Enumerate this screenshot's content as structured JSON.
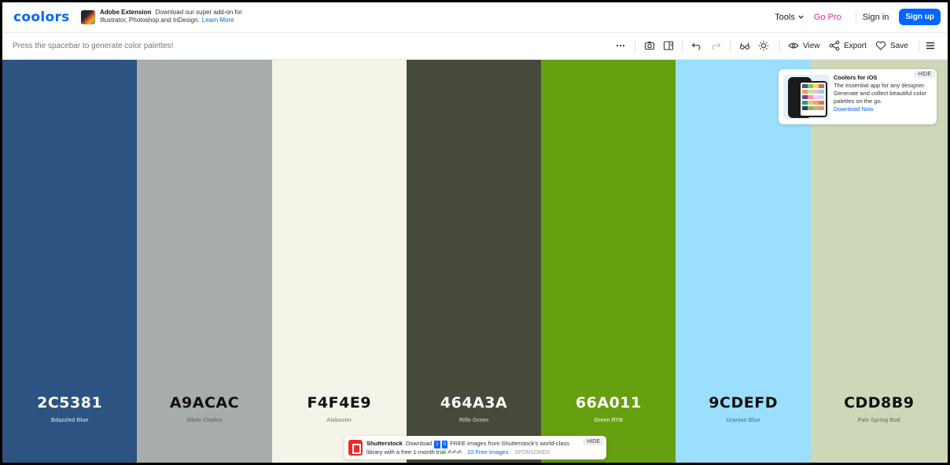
{
  "app": {
    "logo": "coolors"
  },
  "adobe_ad": {
    "title": "Adobe Extension",
    "line1": "Download our super add-on for",
    "line2": "Illustrator, Photoshop and InDesign.",
    "link": "Learn More"
  },
  "nav": {
    "tools": "Tools",
    "gopro": "Go Pro",
    "signin": "Sign in",
    "signup": "Sign up"
  },
  "toolbar": {
    "hint": "Press the spacebar to generate color palettes!",
    "view": "View",
    "export": "Export",
    "save": "Save",
    "icons": [
      "more-icon",
      "camera-icon",
      "panel-icon",
      "undo-icon",
      "redo-icon",
      "glasses-icon",
      "sun-icon",
      "eye-icon",
      "share-icon",
      "heart-icon",
      "menu-icon"
    ]
  },
  "palette": [
    {
      "hex": "2C5381",
      "name": "Bdazzled Blue",
      "color": "#2C5381",
      "text_color": "#ffffff",
      "name_color": "#b9c6d8"
    },
    {
      "hex": "A9ACAC",
      "name": "Silver Chalice",
      "color": "#A9ACAC",
      "text_color": "#111111",
      "name_color": "#6d7070"
    },
    {
      "hex": "F4F4E9",
      "name": "Alabaster",
      "color": "#F4F4E9",
      "text_color": "#111111",
      "name_color": "#9a9a92"
    },
    {
      "hex": "464A3A",
      "name": "Rifle Green",
      "color": "#464A3A",
      "text_color": "#ffffff",
      "name_color": "#b3b5ad"
    },
    {
      "hex": "66A011",
      "name": "Green RYB",
      "color": "#66A011",
      "text_color": "#ffffff",
      "name_color": "#d4e6b7"
    },
    {
      "hex": "9CDEFD",
      "name": "Uranian Blue",
      "color": "#9CDEFD",
      "text_color": "#111111",
      "name_color": "#5c8aa0"
    },
    {
      "hex": "CDD8B9",
      "name": "Pale Spring Bud",
      "color": "#CDD8B9",
      "text_color": "#111111",
      "name_color": "#7f8872"
    }
  ],
  "ios_promo": {
    "title": "Coolors for iOS",
    "body": "The essential app for any designer. Generate and collect beautiful color palettes on the go.",
    "link": "Download Now",
    "hide": "HIDE"
  },
  "shutterstock_ad": {
    "brand": "Shutterstock",
    "pre": "Download",
    "num1": "1",
    "num2": "0",
    "mid": "FREE images from Shutterstock's world-class library with a free 1-month trial",
    "link": "10 Free Images",
    "sponsored": "SPONSORED",
    "hide": "HIDE"
  }
}
